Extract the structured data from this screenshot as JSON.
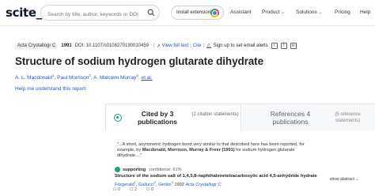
{
  "nav": {
    "logo": "scite_",
    "search_placeholder": "Search by title, author, keywords or DOI",
    "install_label": "Install extension!",
    "links": {
      "assistant": "Assistant",
      "product": "Product",
      "solutions": "Solutions",
      "pricing": "Pricing",
      "help": "Help"
    },
    "chevron": "⌄"
  },
  "paper": {
    "journal": "Acta Crystallogr C",
    "year": "1991",
    "doi": "DOI: 10.1107/s0108270190010459",
    "view_full_text": "View full text",
    "cite": "Cite",
    "sign_up": "Sign up to set email alerts",
    "title": "Structure of sodium hydrogen glutarate dihydrate",
    "authors": [
      {
        "name": "A. L. Macdonald",
        "sup": "1"
      },
      {
        "name": "Paul Morrison",
        "sup": "2"
      },
      {
        "name": "A. Malcolm Murray",
        "sup": "3"
      }
    ],
    "et_al": "et al.",
    "help_link": "Help me understand this report"
  },
  "tabs": {
    "cited_label": "Cited by 3 publications",
    "cited_sub": "(2 citation statements)",
    "refs_label": "References 4 publications",
    "refs_sub": "(5 reference statements)"
  },
  "citation": {
    "quote_start": "\"...A short, asymmetric hydrogen bond very similar to that described here has been reported, for example, by ",
    "quote_bold": "Macdonald, Morrison, Murray & Freer (1991)",
    "quote_end": " for sodium hydrogen glutarate dihydrate....\"",
    "type": "supporting",
    "confidence": "confidence: 61%",
    "title": "Structure of the sodium salt of 1,4,5,8-naphthalenetetracarboxylic acid 4,5-anhydride hydrate",
    "authors": [
      {
        "name": "Fitzgerald",
        "sup": "1"
      },
      {
        "name": "Gallucci",
        "sup": "2"
      },
      {
        "name": "Gerkin",
        "sup": "3"
      }
    ],
    "year": "1992",
    "journal": "Acta Crystallogr C",
    "show_abstract": "show abstract",
    "counters": {
      "supporting": "0",
      "mentioning": "2",
      "contrasting": "0"
    }
  },
  "colors": {
    "accent": "#1a56d6",
    "supporting": "#20a36a"
  }
}
